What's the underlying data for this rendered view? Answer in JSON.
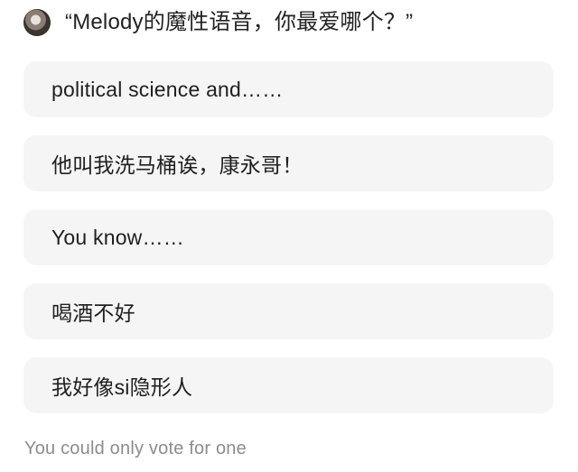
{
  "poll": {
    "title": "“Melody的魔性语音，你最爱哪个？”",
    "options": [
      {
        "label": "political science and……"
      },
      {
        "label": "他叫我洗马桶诶，康永哥！"
      },
      {
        "label": "You know……"
      },
      {
        "label": "喝酒不好"
      },
      {
        "label": "我好像si隐形人"
      }
    ],
    "footer_note": "You could only vote for one"
  }
}
